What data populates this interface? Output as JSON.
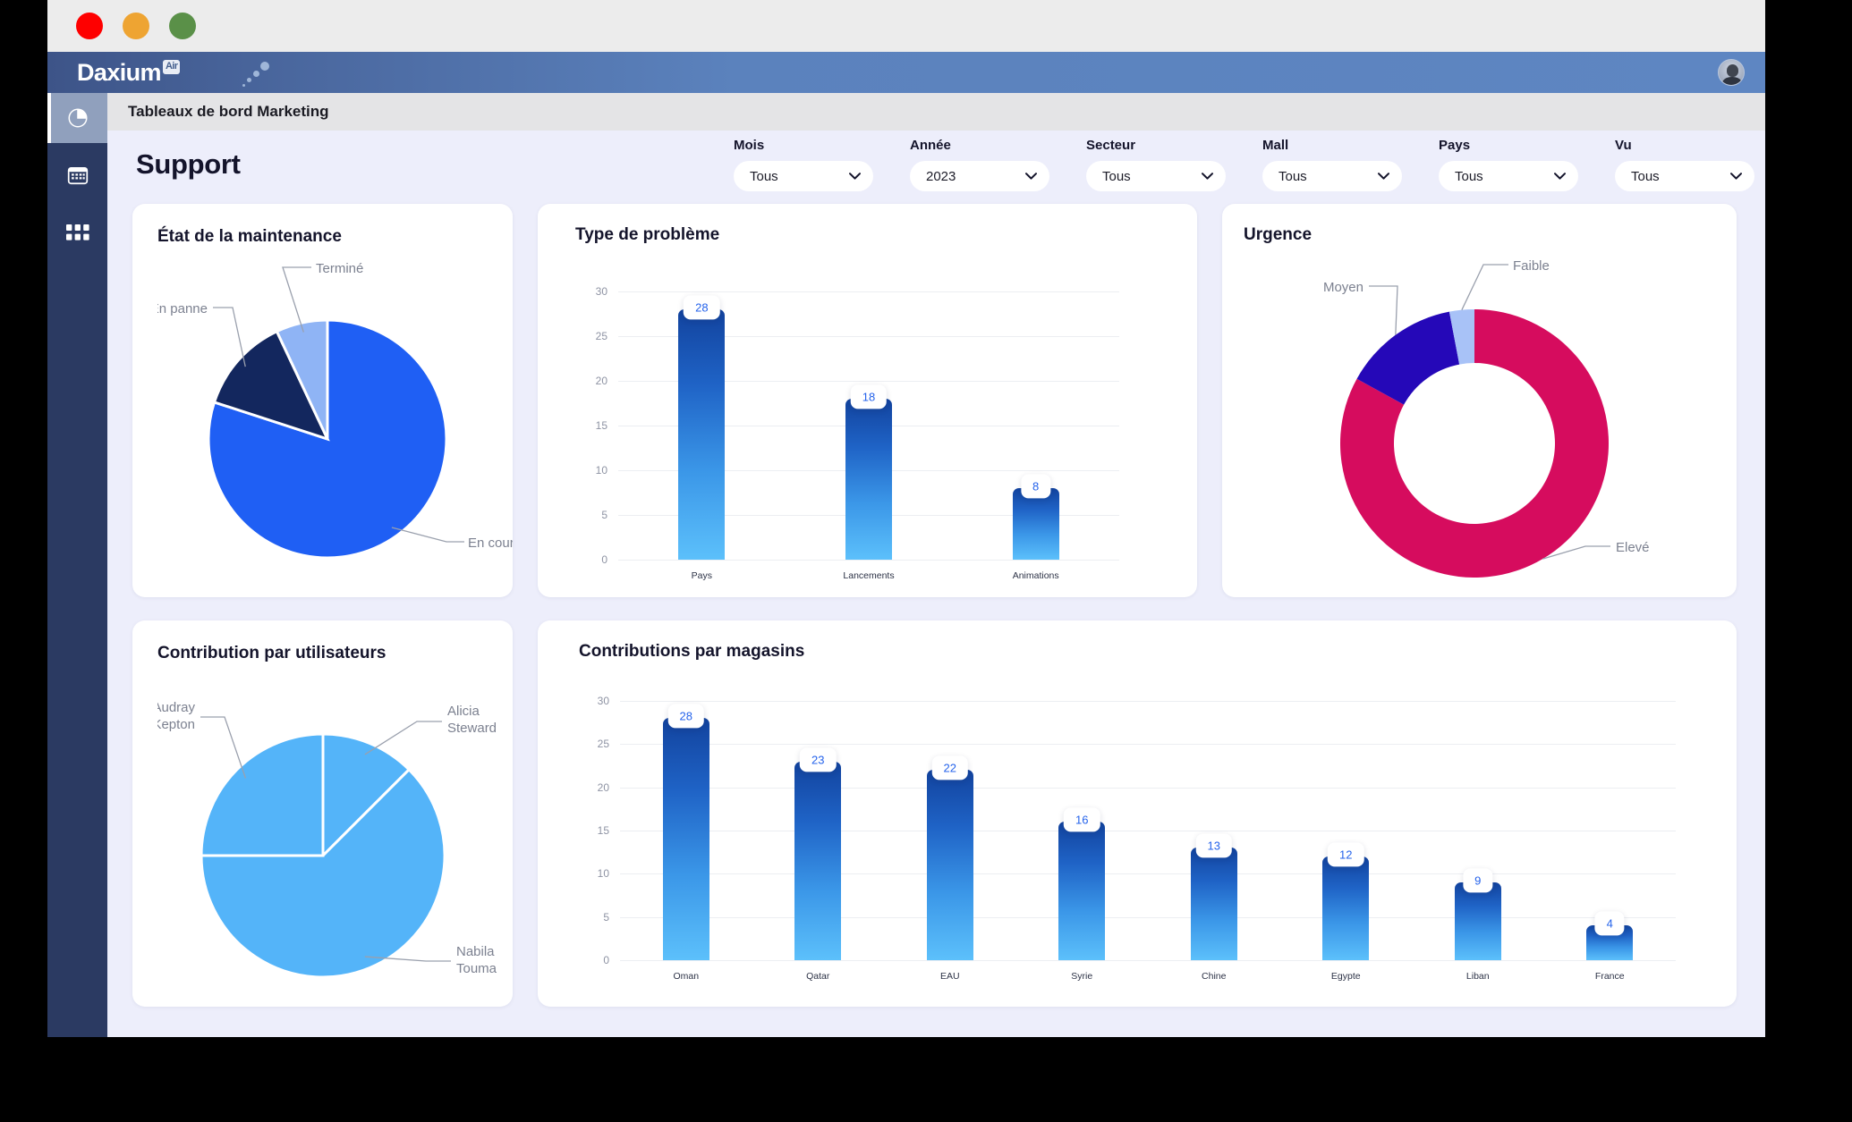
{
  "window": {
    "traffic_lights": [
      "close",
      "minimize",
      "maximize"
    ]
  },
  "appbar": {
    "brand": "Daxium",
    "brand_sup": "Air",
    "avatar_name": "user-avatar"
  },
  "sidebar": {
    "items": [
      {
        "icon": "pie-chart-icon",
        "name": "dashboards",
        "active": true
      },
      {
        "icon": "calendar-icon",
        "name": "calendar",
        "active": false
      },
      {
        "icon": "grid-apps-icon",
        "name": "apps",
        "active": false
      }
    ]
  },
  "breadcrumb": "Tableaux de bord Marketing",
  "page_title": "Support",
  "filters": [
    {
      "label": "Mois",
      "value": "Tous"
    },
    {
      "label": "Année",
      "value": "2023"
    },
    {
      "label": "Secteur",
      "value": "Tous"
    },
    {
      "label": "Mall",
      "value": "Tous"
    },
    {
      "label": "Pays",
      "value": "Tous"
    },
    {
      "label": "Vu",
      "value": "Tous"
    }
  ],
  "cards": {
    "maintenance": {
      "title": "État de la maintenance"
    },
    "probleme": {
      "title": "Type de problème"
    },
    "urgence": {
      "title": "Urgence"
    },
    "contribution": {
      "title": "Contribution par utilisateurs"
    },
    "magasins": {
      "title": "Contributions par magasins"
    }
  },
  "colors": {
    "primary_blue": "#1f5ff4",
    "navy": "#13275e",
    "light_blue": "#8fb4f5",
    "pink": "#d60c5e",
    "indigo": "#2508b8",
    "periwinkle": "#a8c2f7",
    "sky": "#54b4f9",
    "bar_top": "#12439e",
    "bar_bottom": "#5cc0fb",
    "badge_text": "#2563eb",
    "sidebar": "#2b3a62",
    "appbar": "#5b82bd",
    "page_bg": "#edeefb"
  },
  "chart_data": [
    {
      "type": "pie",
      "id": "etat-maintenance",
      "title": "État de la maintenance",
      "categories": [
        "En cours",
        "En panne",
        "Terminé"
      ],
      "values": [
        80,
        13,
        7
      ],
      "colors": [
        "#1f5ff4",
        "#13275e",
        "#8fb4f5"
      ],
      "legend": "leader-lines",
      "labels": [
        "En cours",
        "En panne",
        "Terminé"
      ]
    },
    {
      "type": "bar",
      "id": "type-de-probleme",
      "title": "Type de problème",
      "categories": [
        "Pays",
        "Lancements",
        "Animations"
      ],
      "values": [
        28,
        18,
        8
      ],
      "xlabel": "",
      "ylabel": "",
      "ylim": [
        0,
        30
      ],
      "yticks": [
        30,
        25,
        20,
        15,
        10,
        5,
        0
      ],
      "grid": true,
      "legend": "none"
    },
    {
      "type": "pie",
      "id": "urgence",
      "title": "Urgence",
      "subtype": "donut",
      "categories": [
        "Elevé",
        "Moyen",
        "Faible"
      ],
      "values": [
        83,
        14,
        3
      ],
      "colors": [
        "#d60c5e",
        "#2508b8",
        "#a8c2f7"
      ],
      "legend": "leader-lines",
      "labels": [
        "Elevé",
        "Moyen",
        "Faible"
      ]
    },
    {
      "type": "pie",
      "id": "contribution-par-utilisateurs",
      "title": "Contribution par utilisateurs",
      "categories": [
        "Alicia Steward",
        "Nabila Touma",
        "Audray Kepton"
      ],
      "values": [
        12.5,
        62.5,
        25
      ],
      "colors": [
        "#54b4f9",
        "#54b4f9",
        "#54b4f9"
      ],
      "legend": "leader-lines",
      "labels": [
        "Alicia\nSteward",
        "Nabila\nTouma",
        "Audray\nKepton"
      ]
    },
    {
      "type": "bar",
      "id": "contributions-par-magasins",
      "title": "Contributions par magasins",
      "categories": [
        "Oman",
        "Qatar",
        "EAU",
        "Syrie",
        "Chine",
        "Egypte",
        "Liban",
        "France"
      ],
      "values": [
        28,
        23,
        22,
        16,
        13,
        12,
        9,
        4
      ],
      "xlabel": "",
      "ylabel": "",
      "ylim": [
        0,
        30
      ],
      "yticks": [
        30,
        25,
        20,
        15,
        10,
        5,
        0
      ],
      "grid": true,
      "legend": "none"
    }
  ]
}
